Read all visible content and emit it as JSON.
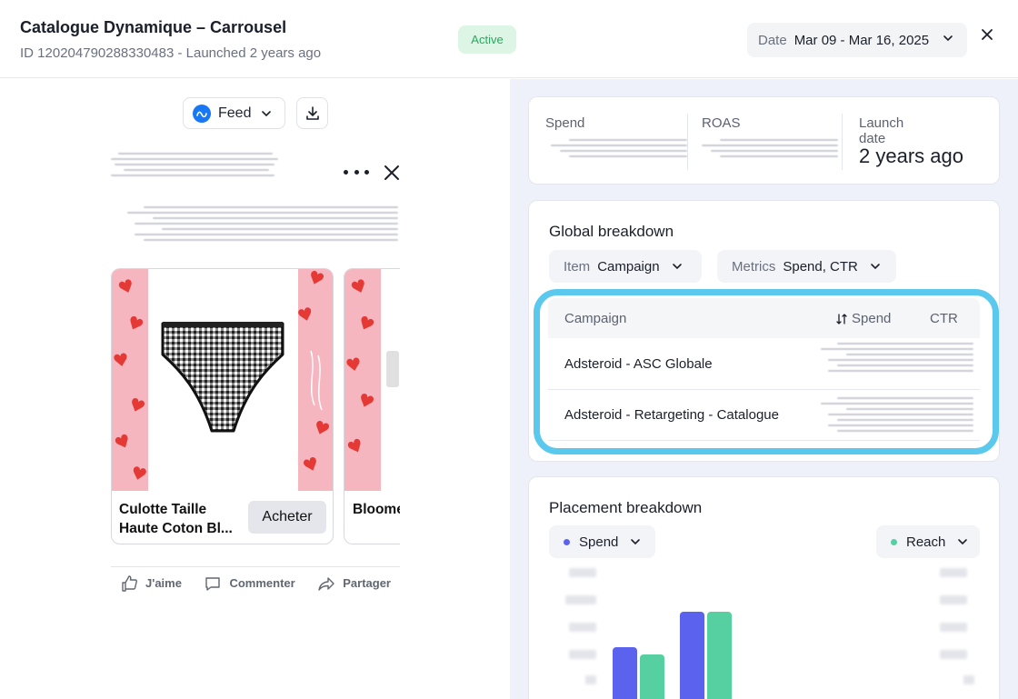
{
  "header": {
    "title": "Catalogue Dynamique – Carrousel",
    "subtitle": "ID 120204790288330483 - Launched 2 years ago",
    "status": "Active",
    "date_label": "Date",
    "date_value": "Mar 09 - Mar 16, 2025"
  },
  "preview": {
    "placement": "Feed",
    "card1_title": "Culotte Taille Haute Coton Bl...",
    "card1_cta": "Acheter",
    "card2_title": "Bloomers BIO - B",
    "actions": {
      "like": "J'aime",
      "comment": "Commenter",
      "share": "Partager"
    }
  },
  "stats": {
    "spend_label": "Spend",
    "roas_label": "ROAS",
    "launch_label": "Launch date",
    "launch_value": "2 years ago"
  },
  "global_breakdown": {
    "title": "Global breakdown",
    "item_label": "Item",
    "item_value": "Campaign",
    "metrics_label": "Metrics",
    "metrics_value": "Spend, CTR",
    "columns": [
      "Campaign",
      "Spend",
      "CTR"
    ],
    "rows": [
      {
        "campaign": "Adsteroid - ASC Globale"
      },
      {
        "campaign": "Adsteroid - Retargeting - Catalogue"
      }
    ]
  },
  "placement_breakdown": {
    "title": "Placement breakdown",
    "left_metric": "Spend",
    "right_metric": "Reach",
    "colors": {
      "spend": "#5b63ee",
      "reach": "#56d0a0"
    },
    "chart_data": {
      "type": "bar",
      "series": [
        {
          "name": "Spend",
          "values": [
            0.58,
            1.0
          ]
        },
        {
          "name": "Reach",
          "values": [
            0.5,
            1.0
          ]
        }
      ]
    }
  }
}
